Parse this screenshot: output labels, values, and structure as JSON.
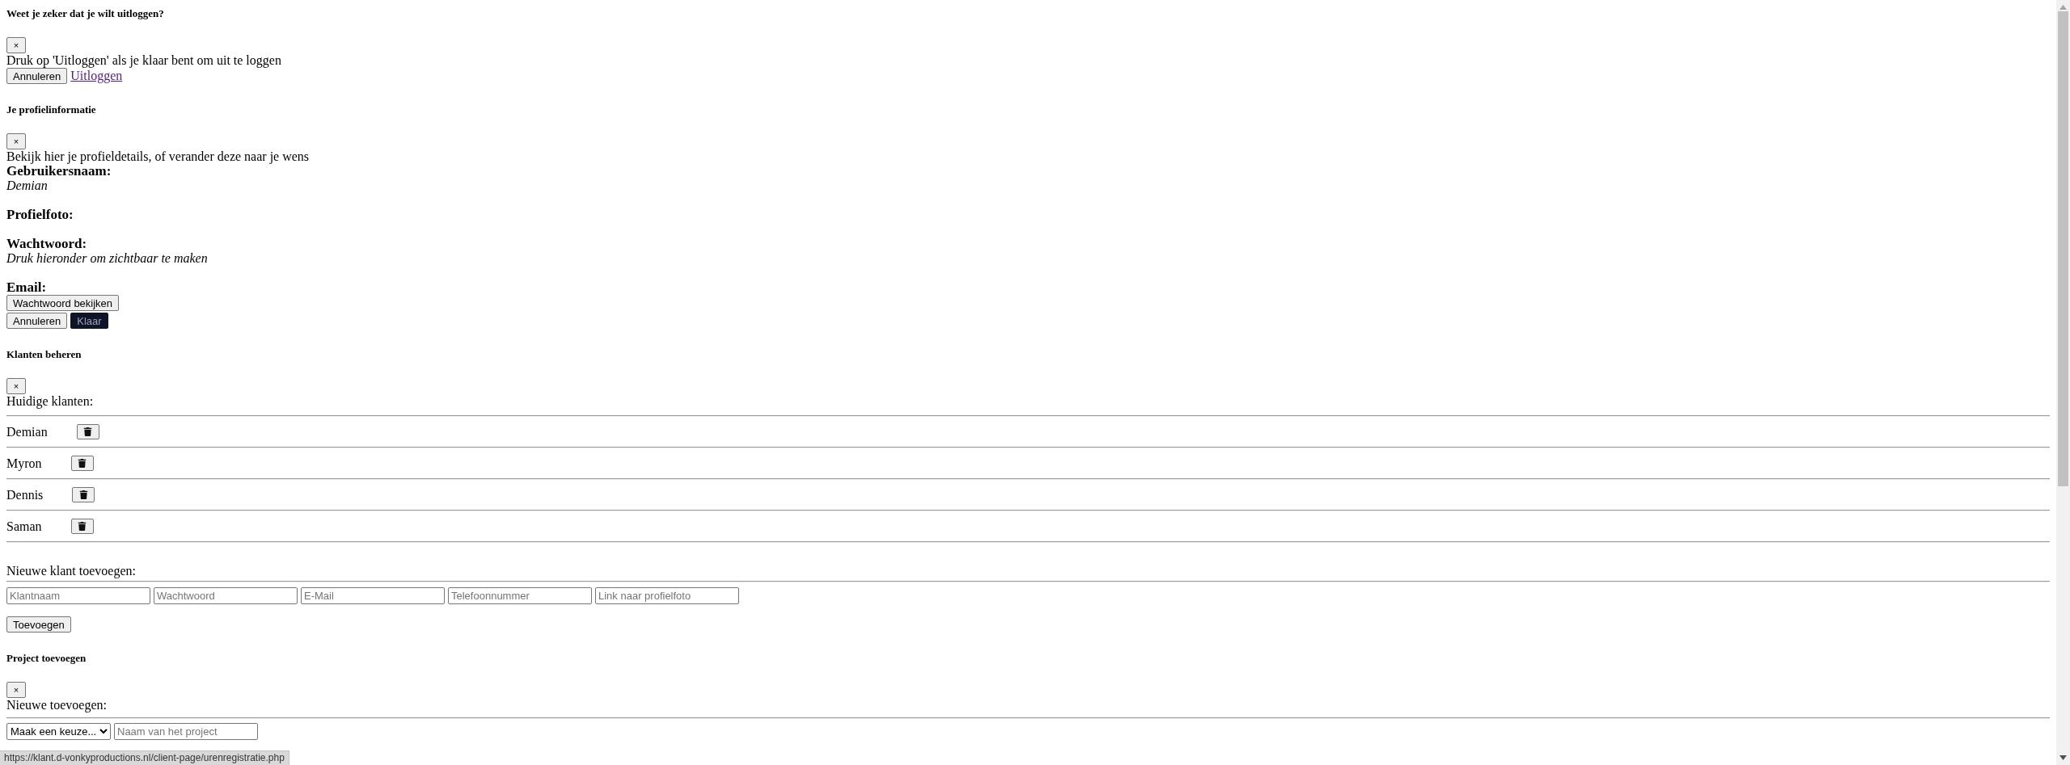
{
  "logout_dialog": {
    "title": "Weet je zeker dat je wilt uitloggen?",
    "close_label": "×",
    "message": "Druk op 'Uitloggen' als je klaar bent om uit te loggen",
    "actions": [
      {
        "kind": "button",
        "label": "Annuleren"
      },
      {
        "kind": "link",
        "label": "Uitloggen"
      }
    ]
  },
  "profile_dialog": {
    "title": "Je profielinformatie",
    "close_label": "×",
    "message": "Bekijk hier je profieldetails, of verander deze naar je wens",
    "fields": [
      {
        "label": "Gebruikersnaam:",
        "value": "Demian"
      },
      {
        "label": "Profielfoto:"
      },
      {
        "label": "Wachtwoord:",
        "value": "Druk hieronder om zichtbaar te maken"
      },
      {
        "label": "Email:"
      }
    ],
    "reveal_button": "Wachtwoord bekijken",
    "actions": [
      {
        "kind": "plain",
        "label": "Annuleren"
      },
      {
        "kind": "dark",
        "label": "Klaar"
      }
    ]
  },
  "clients_dialog": {
    "title": "Klanten beheren",
    "close_label": "×",
    "current_heading": "Huidige klanten:",
    "clients": [
      {
        "name": "Demian"
      },
      {
        "name": "Myron"
      },
      {
        "name": "Dennis"
      },
      {
        "name": "Saman"
      }
    ],
    "new_heading": "Nieuwe klant toevoegen:",
    "inputs": [
      {
        "placeholder": "Klantnaam"
      },
      {
        "placeholder": "Wachtwoord"
      },
      {
        "placeholder": "E-Mail"
      },
      {
        "placeholder": "Telefoonnummer"
      },
      {
        "placeholder": "Link naar profielfoto"
      }
    ],
    "submit": "Toevoegen"
  },
  "project_dialog": {
    "title": "Project toevoegen",
    "close_label": "×",
    "new_heading": "Nieuwe toevoegen:",
    "select": {
      "value": "Maak een keuze..."
    },
    "name_input": {
      "placeholder": "Naam van het project"
    }
  },
  "status_bar": {
    "url": "https://klant.d-vonkyproductions.nl/client-page/urenregistratie.php"
  }
}
